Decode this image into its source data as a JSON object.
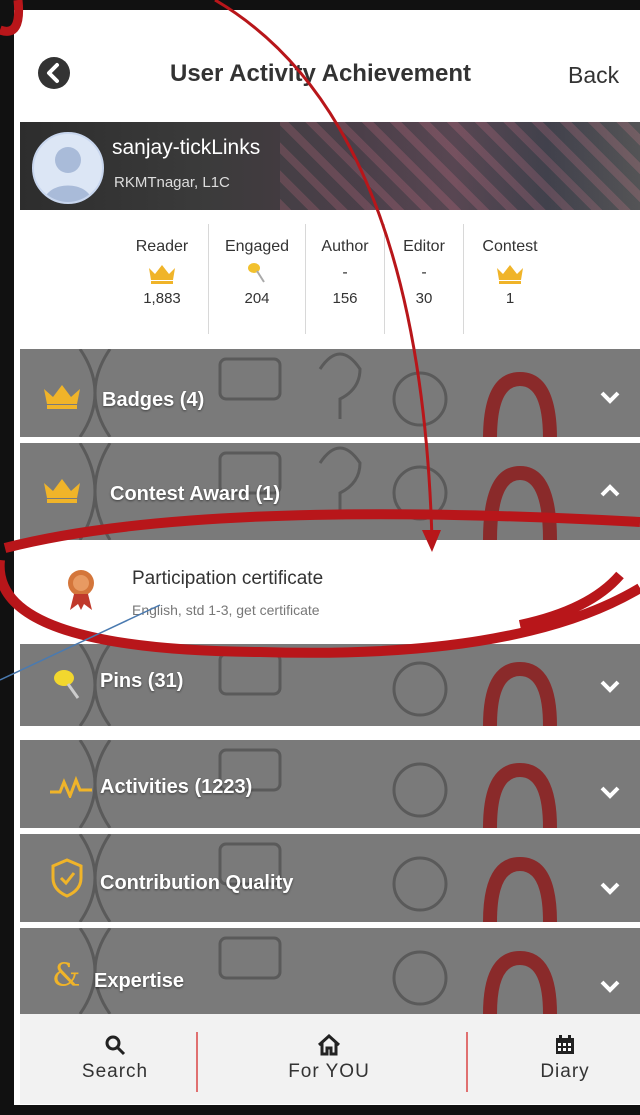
{
  "header": {
    "title": "User Activity Achievement",
    "back_label": "Back",
    "back_icon": "chevron-left-circle"
  },
  "profile": {
    "name": "sanjay-tickLinks",
    "location": "RKMTnagar, L1C"
  },
  "stats": [
    {
      "label": "Reader",
      "icon": "crown-icon",
      "display": "",
      "value": "1,883"
    },
    {
      "label": "Engaged",
      "icon": "pin-icon",
      "display": "",
      "value": "204"
    },
    {
      "label": "Author",
      "icon": "",
      "display": "-",
      "value": "156"
    },
    {
      "label": "Editor",
      "icon": "",
      "display": "-",
      "value": "30"
    },
    {
      "label": "Contest",
      "icon": "crown-icon",
      "display": "",
      "value": "1"
    }
  ],
  "sections": [
    {
      "label": "Badges (4)",
      "icon": "crown-icon",
      "chevron": "chevron-down"
    },
    {
      "label": "Contest Award (1)",
      "icon": "crown-icon",
      "chevron": "chevron-up"
    },
    {
      "label": "Pins (31)",
      "icon": "pin-icon",
      "chevron": "chevron-down"
    },
    {
      "label": "Activities (1223)",
      "icon": "activity-icon",
      "chevron": "chevron-down"
    },
    {
      "label": "Contribution Quality",
      "icon": "shield-icon",
      "chevron": "chevron-down"
    },
    {
      "label": "Expertise",
      "icon": "ampersand-icon",
      "chevron": "chevron-down"
    }
  ],
  "award": {
    "title": "Participation certificate",
    "subtitle": "English, std 1-3, get certificate",
    "icon": "medal-icon"
  },
  "nav": [
    {
      "label": "Search",
      "icon": "search-icon"
    },
    {
      "label": "For YOU",
      "icon": "home-icon"
    },
    {
      "label": "Diary",
      "icon": "calendar-icon"
    }
  ],
  "colors": {
    "annotation": "#b8161a",
    "crown": "#f0b429",
    "divider": "#e07070"
  }
}
